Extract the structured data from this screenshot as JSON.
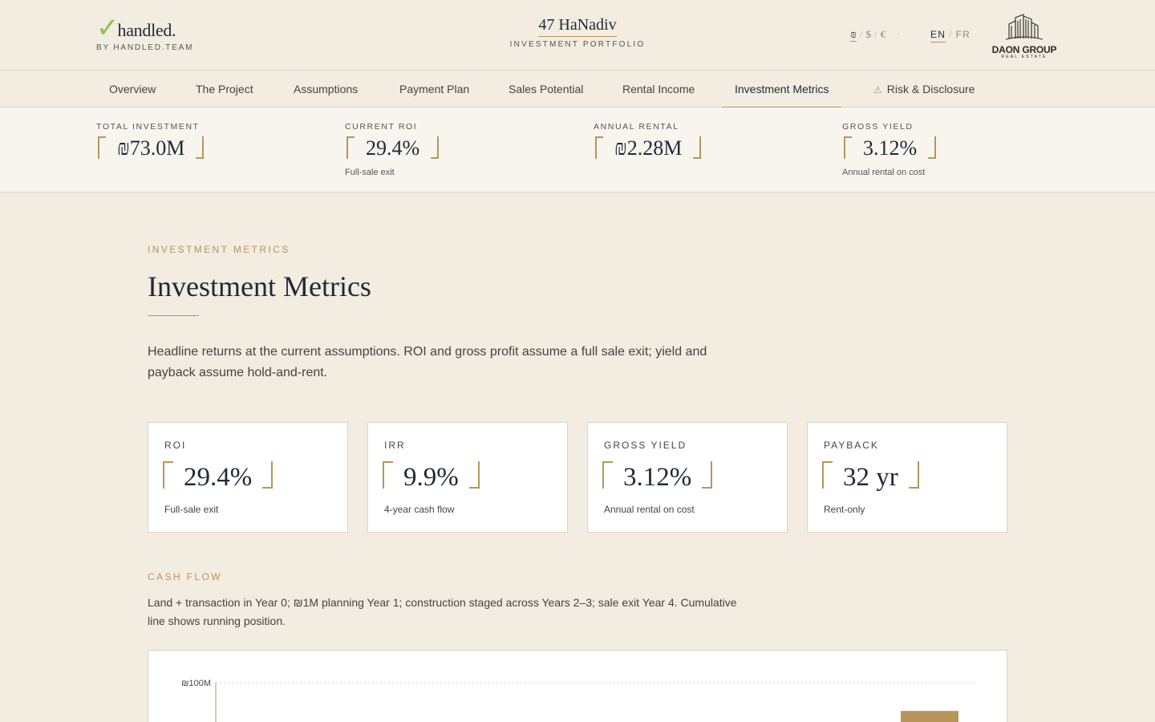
{
  "brand": {
    "check": "✓",
    "name": "handled.",
    "sub": "BY HANDLED.TEAM"
  },
  "project": {
    "title": "47 HaNadiv",
    "subtitle": "INVESTMENT PORTFOLIO"
  },
  "currencies": [
    {
      "symbol": "₪",
      "active": true
    },
    {
      "symbol": "$",
      "active": false
    },
    {
      "symbol": "€",
      "active": false
    }
  ],
  "languages": [
    {
      "code": "EN",
      "active": true
    },
    {
      "code": "FR",
      "active": false
    }
  ],
  "partner_logo": {
    "name": "DAON GROUP",
    "sub": "REAL ESTATE"
  },
  "tabs": [
    {
      "label": "Overview",
      "active": false
    },
    {
      "label": "The Project",
      "active": false
    },
    {
      "label": "Assumptions",
      "active": false
    },
    {
      "label": "Payment Plan",
      "active": false
    },
    {
      "label": "Sales Potential",
      "active": false
    },
    {
      "label": "Rental Income",
      "active": false
    },
    {
      "label": "Investment Metrics",
      "active": true
    },
    {
      "label": "Risk & Disclosure",
      "active": false,
      "icon": "warning-icon"
    }
  ],
  "summary": [
    {
      "label": "TOTAL INVESTMENT",
      "value": "₪73.0M",
      "sub": ""
    },
    {
      "label": "CURRENT ROI",
      "value": "29.4%",
      "sub": "Full-sale exit"
    },
    {
      "label": "ANNUAL RENTAL",
      "value": "₪2.28M",
      "sub": ""
    },
    {
      "label": "GROSS YIELD",
      "value": "3.12%",
      "sub": "Annual rental on cost"
    }
  ],
  "section": {
    "eyebrow": "INVESTMENT METRICS",
    "title": "Investment Metrics",
    "lead": "Headline returns at the current assumptions. ROI and gross profit assume a full sale exit; yield and payback assume hold-and-rent."
  },
  "metrics": [
    {
      "label": "ROI",
      "value": "29.4%",
      "sub": "Full-sale exit"
    },
    {
      "label": "IRR",
      "value": "9.9%",
      "sub": "4-year cash flow"
    },
    {
      "label": "GROSS YIELD",
      "value": "3.12%",
      "sub": "Annual rental on cost"
    },
    {
      "label": "PAYBACK",
      "value": "32 yr",
      "sub": "Rent-only"
    }
  ],
  "cashflow": {
    "eyebrow": "CASH FLOW",
    "description": "Land + transaction in Year 0; ₪1M planning Year 1; construction staged across Years 2–3; sale exit Year 4. Cumulative line shows running position."
  },
  "chart_data": {
    "type": "bar",
    "tick_labels": [
      "₪100M"
    ],
    "visible_bars": [
      {
        "value": 94.5
      }
    ],
    "ylim_top": 100
  },
  "colors": {
    "accent": "#b8955a",
    "ink": "#1f2a38",
    "background": "#f2ece1",
    "check": "#8fc24a"
  }
}
